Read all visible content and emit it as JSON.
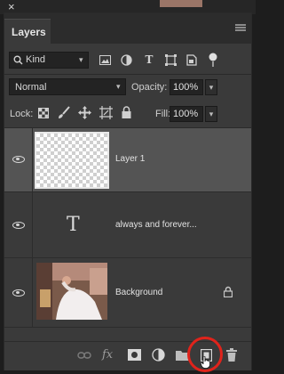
{
  "window": {
    "close_glyph": "×"
  },
  "panel": {
    "tab_label": "Layers"
  },
  "filter": {
    "kind_label": "Kind",
    "icons": [
      "image-filter-icon",
      "adjustment-filter-icon",
      "type-filter-icon",
      "shape-filter-icon",
      "smart-object-filter-icon",
      "filter-toggle-icon"
    ]
  },
  "blend": {
    "mode": "Normal",
    "opacity_label": "Opacity:",
    "opacity_value": "100%"
  },
  "lock": {
    "label": "Lock:",
    "fill_label": "Fill:",
    "fill_value": "100%"
  },
  "layers": [
    {
      "name": "Layer 1",
      "selected": true,
      "thumb": "transparent"
    },
    {
      "name": "always and forever...",
      "selected": false,
      "thumb": "type",
      "type_glyph": "T"
    },
    {
      "name": "Background",
      "selected": false,
      "thumb": "photo",
      "locked": true
    }
  ],
  "bottom_icons": [
    "link-layers-icon",
    "fx-icon",
    "add-mask-icon",
    "adjustment-layer-icon",
    "new-group-icon",
    "new-layer-icon",
    "delete-layer-icon"
  ],
  "accent_colors": {
    "highlight_ring": "#e0231b"
  }
}
